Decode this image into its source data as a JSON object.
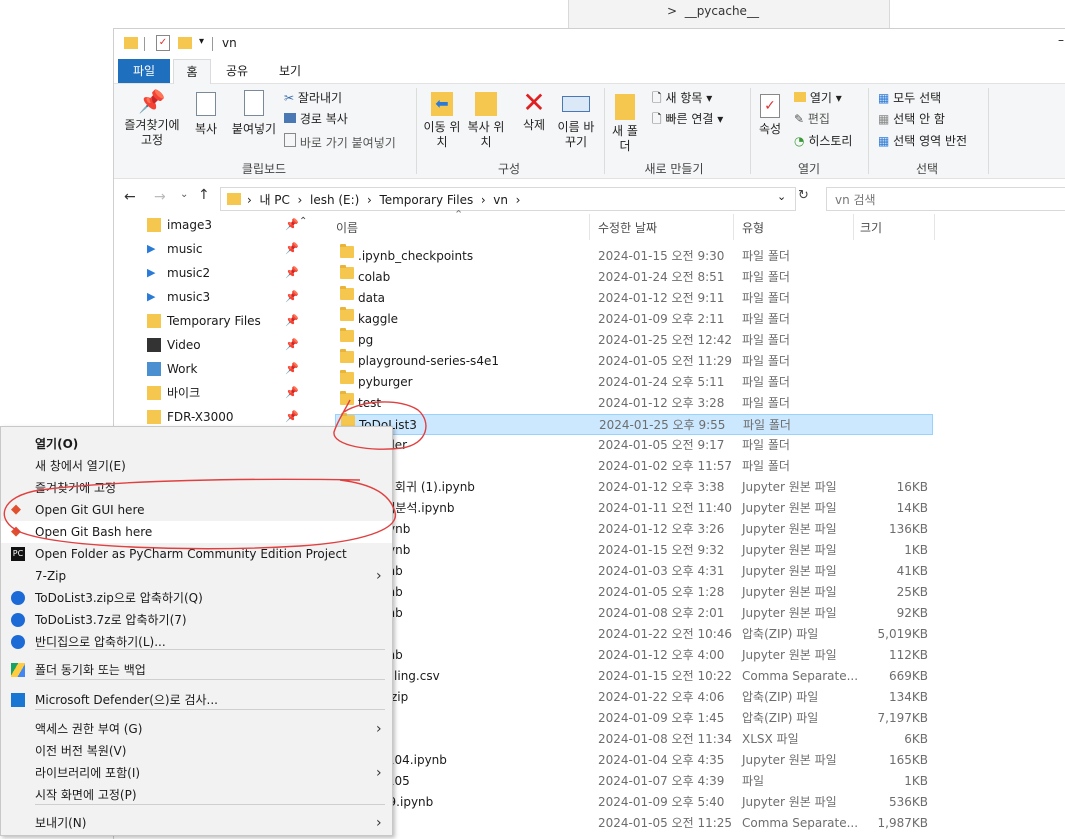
{
  "background_window": {
    "folder_item": "__pycache__"
  },
  "window": {
    "title": "vn"
  },
  "ribbon_tabs": [
    "파일",
    "홈",
    "공유",
    "보기"
  ],
  "ribbon": {
    "clipboard": {
      "pin": "즐겨찾기에 고정",
      "copy": "복사",
      "paste": "붙여넣기",
      "cut": "잘라내기",
      "copy_path": "경로 복사",
      "paste_shortcut": "바로 가기 붙여넣기",
      "group": "클립보드"
    },
    "organize": {
      "move": "이동 위치",
      "copyto": "복사 위치",
      "delete": "삭제",
      "rename": "이름 바꾸기",
      "group": "구성"
    },
    "new": {
      "folder": "새 폴더",
      "new_item": "새 항목",
      "easy_access": "빠른 연결",
      "group": "새로 만들기"
    },
    "open": {
      "properties": "속성",
      "open": "열기",
      "edit": "편집",
      "history": "히스토리",
      "group": "열기"
    },
    "select": {
      "all": "모두 선택",
      "none": "선택 안 함",
      "invert": "선택 영역 반전",
      "group": "선택"
    }
  },
  "address": {
    "crumbs": [
      "내 PC",
      "lesh (E:)",
      "Temporary Files",
      "vn"
    ],
    "search_placeholder": "vn 검색"
  },
  "nav_items": [
    {
      "label": "image3",
      "icon": "folder-icon"
    },
    {
      "label": "music",
      "icon": "music-icon"
    },
    {
      "label": "music2",
      "icon": "music-icon"
    },
    {
      "label": "music3",
      "icon": "music-icon"
    },
    {
      "label": "Temporary Files",
      "icon": "folder-icon"
    },
    {
      "label": "Video",
      "icon": "video-icon"
    },
    {
      "label": "Work",
      "icon": "work-icon"
    },
    {
      "label": "바이크",
      "icon": "folder-icon"
    },
    {
      "label": "FDR-X3000",
      "icon": "folder-icon"
    }
  ],
  "columns": {
    "name": "이름",
    "date": "수정한 날짜",
    "type": "유형",
    "size": "크기"
  },
  "files": [
    {
      "name": ".ipynb_checkpoints",
      "date": "2024-01-15 오전 9:30",
      "type": "파일 폴더",
      "size": ""
    },
    {
      "name": "colab",
      "date": "2024-01-24 오전 8:51",
      "type": "파일 폴더",
      "size": ""
    },
    {
      "name": "data",
      "date": "2024-01-12 오전 9:11",
      "type": "파일 폴더",
      "size": ""
    },
    {
      "name": "kaggle",
      "date": "2024-01-09 오후 2:11",
      "type": "파일 폴더",
      "size": ""
    },
    {
      "name": "pg",
      "date": "2024-01-25 오전 12:42",
      "type": "파일 폴더",
      "size": ""
    },
    {
      "name": "playground-series-s4e1",
      "date": "2024-01-05 오전 11:29",
      "type": "파일 폴더",
      "size": ""
    },
    {
      "name": "pyburger",
      "date": "2024-01-24 오후 5:11",
      "type": "파일 폴더",
      "size": ""
    },
    {
      "name": "test",
      "date": "2024-01-12 오후 3:28",
      "type": "파일 폴더",
      "size": ""
    },
    {
      "name": "ToDoList3",
      "date": "2024-01-25 오후 9:55",
      "type": "파일 폴더",
      "size": ""
    },
    {
      "name": "d-Folder",
      "date": "2024-01-05 오전 9:17",
      "type": "파일 폴더",
      "size": ""
    },
    {
      "name": "",
      "date": "2024-01-02 오후 11:57",
      "type": "파일 폴더",
      "size": ""
    },
    {
      "name": "출문제 회귀 (1).ipynb",
      "date": "2024-01-12 오후 3:38",
      "type": "Jupyter 원본 파일",
      "size": "16KB"
    },
    {
      "name": "11통계분석.ipynb",
      "date": "2024-01-11 오전 11:40",
      "type": "Jupyter 원본 파일",
      "size": "14KB"
    },
    {
      "name": "12.ipynb",
      "date": "2024-01-12 오후 3:26",
      "type": "Jupyter 원본 파일",
      "size": "136KB"
    },
    {
      "name": "15.ipynb",
      "date": "2024-01-15 오전 9:32",
      "type": "Jupyter 원본 파일",
      "size": "1KB"
    },
    {
      "name": "3.ipynb",
      "date": "2024-01-03 오후 4:31",
      "type": "Jupyter 원본 파일",
      "size": "41KB"
    },
    {
      "name": "5.ipynb",
      "date": "2024-01-05 오후 1:28",
      "type": "Jupyter 원본 파일",
      "size": "25KB"
    },
    {
      "name": "3.ipynb",
      "date": "2024-01-08 오후 2:01",
      "type": "Jupyter 원본 파일",
      "size": "92KB"
    },
    {
      "name": "ip",
      "date": "2024-01-22 오전 10:46",
      "type": "압축(ZIP) 파일",
      "size": "5,019KB"
    },
    {
      "name": "2.ipynb",
      "date": "2024-01-12 오후 4:00",
      "type": "Jupyter 원본 파일",
      "size": "112KB"
    },
    {
      "name": "Modelling.csv",
      "date": "2024-01-15 오전 10:22",
      "type": "Comma Separate...",
      "size": "669KB"
    },
    {
      "name": "-web.zip",
      "date": "2024-01-22 오후 4:06",
      "type": "압축(ZIP) 파일",
      "size": "134KB"
    },
    {
      "name": "zip",
      "date": "2024-01-09 오후 1:45",
      "type": "압축(ZIP) 파일",
      "size": "7,197KB"
    },
    {
      "name": "xlsx",
      "date": "2024-01-08 오전 11:34",
      "type": "XLSX 파일",
      "size": "6KB"
    },
    {
      "name": "_230104.ipynb",
      "date": "2024-01-04 오후 4:35",
      "type": "Jupyter 원본 파일",
      "size": "165KB"
    },
    {
      "name": "_240105",
      "date": "2024-01-07 오후 4:39",
      "type": "파일",
      "size": "1KB"
    },
    {
      "name": "40109.ipynb",
      "date": "2024-01-09 오후 5:40",
      "type": "Jupyter 원본 파일",
      "size": "536KB"
    },
    {
      "name": "sv",
      "date": "2024-01-05 오전 11:25",
      "type": "Comma Separate...",
      "size": "1,987KB"
    }
  ],
  "context_menu": [
    {
      "label": "열기(O)",
      "bold": true
    },
    {
      "label": "새 창에서 열기(E)"
    },
    {
      "label": "즐겨찾기에 고정"
    },
    {
      "label": "Open Git GUI here",
      "icon": "git-gui-icon"
    },
    {
      "label": "Open Git Bash here",
      "icon": "git-bash-icon"
    },
    {
      "label": "Open Folder as PyCharm Community Edition Project",
      "icon": "pycharm-icon"
    },
    {
      "label": "7-Zip",
      "submenu": true
    },
    {
      "label": "ToDoList3.zip으로 압축하기(Q)",
      "icon": "bandizip-icon"
    },
    {
      "label": "ToDoList3.7z로 압축하기(7)",
      "icon": "bandizip-icon"
    },
    {
      "label": "반디집으로 압축하기(L)...",
      "icon": "bandizip-icon"
    },
    {
      "label": "폴더 동기화 또는 백업",
      "icon": "google-drive-icon"
    },
    {
      "label": "Microsoft Defender(으)로 검사...",
      "icon": "defender-icon"
    },
    {
      "label": "액세스 권한 부여 (G)",
      "submenu": true
    },
    {
      "label": "이전 버전 복원(V)"
    },
    {
      "label": "라이브러리에 포함(I)",
      "submenu": true
    },
    {
      "label": "시작 화면에 고정(P)"
    },
    {
      "label": "보내기(N)",
      "submenu": true
    }
  ]
}
